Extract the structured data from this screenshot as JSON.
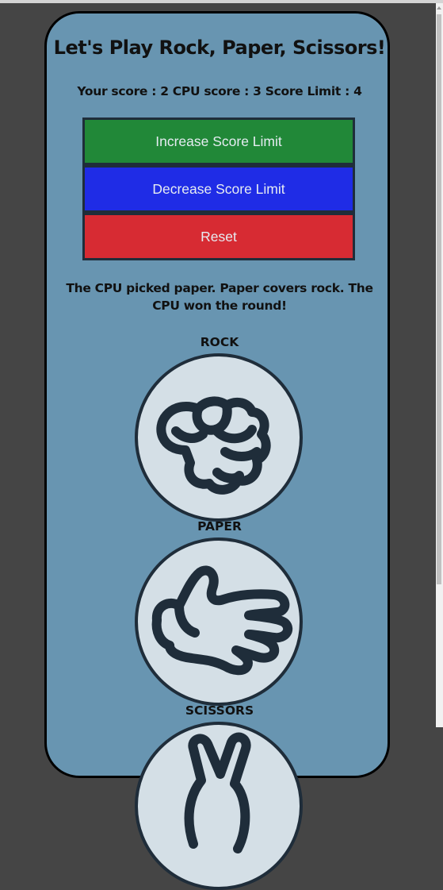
{
  "header": {
    "title": "Let's Play Rock, Paper, Scissors!"
  },
  "scoreboard": {
    "text": "Your score : 2 CPU score : 3 Score Limit : 4"
  },
  "buttons": {
    "increase_label": "Increase Score Limit",
    "decrease_label": "Decrease Score Limit",
    "reset_label": "Reset"
  },
  "result": {
    "message": "The CPU picked paper. Paper covers rock. The CPU won the round!"
  },
  "choices": [
    {
      "label": "ROCK",
      "icon": "rock-hand-icon"
    },
    {
      "label": "PAPER",
      "icon": "paper-hand-icon"
    },
    {
      "label": "SCISSORS",
      "icon": "scissors-hand-icon"
    }
  ],
  "colors": {
    "card_bg": "#6895b1",
    "increase": "#218838",
    "decrease": "#1f2ce6",
    "reset": "#d72b33",
    "circle_bg": "#d4dfe6",
    "outline": "#1f2d3a"
  }
}
